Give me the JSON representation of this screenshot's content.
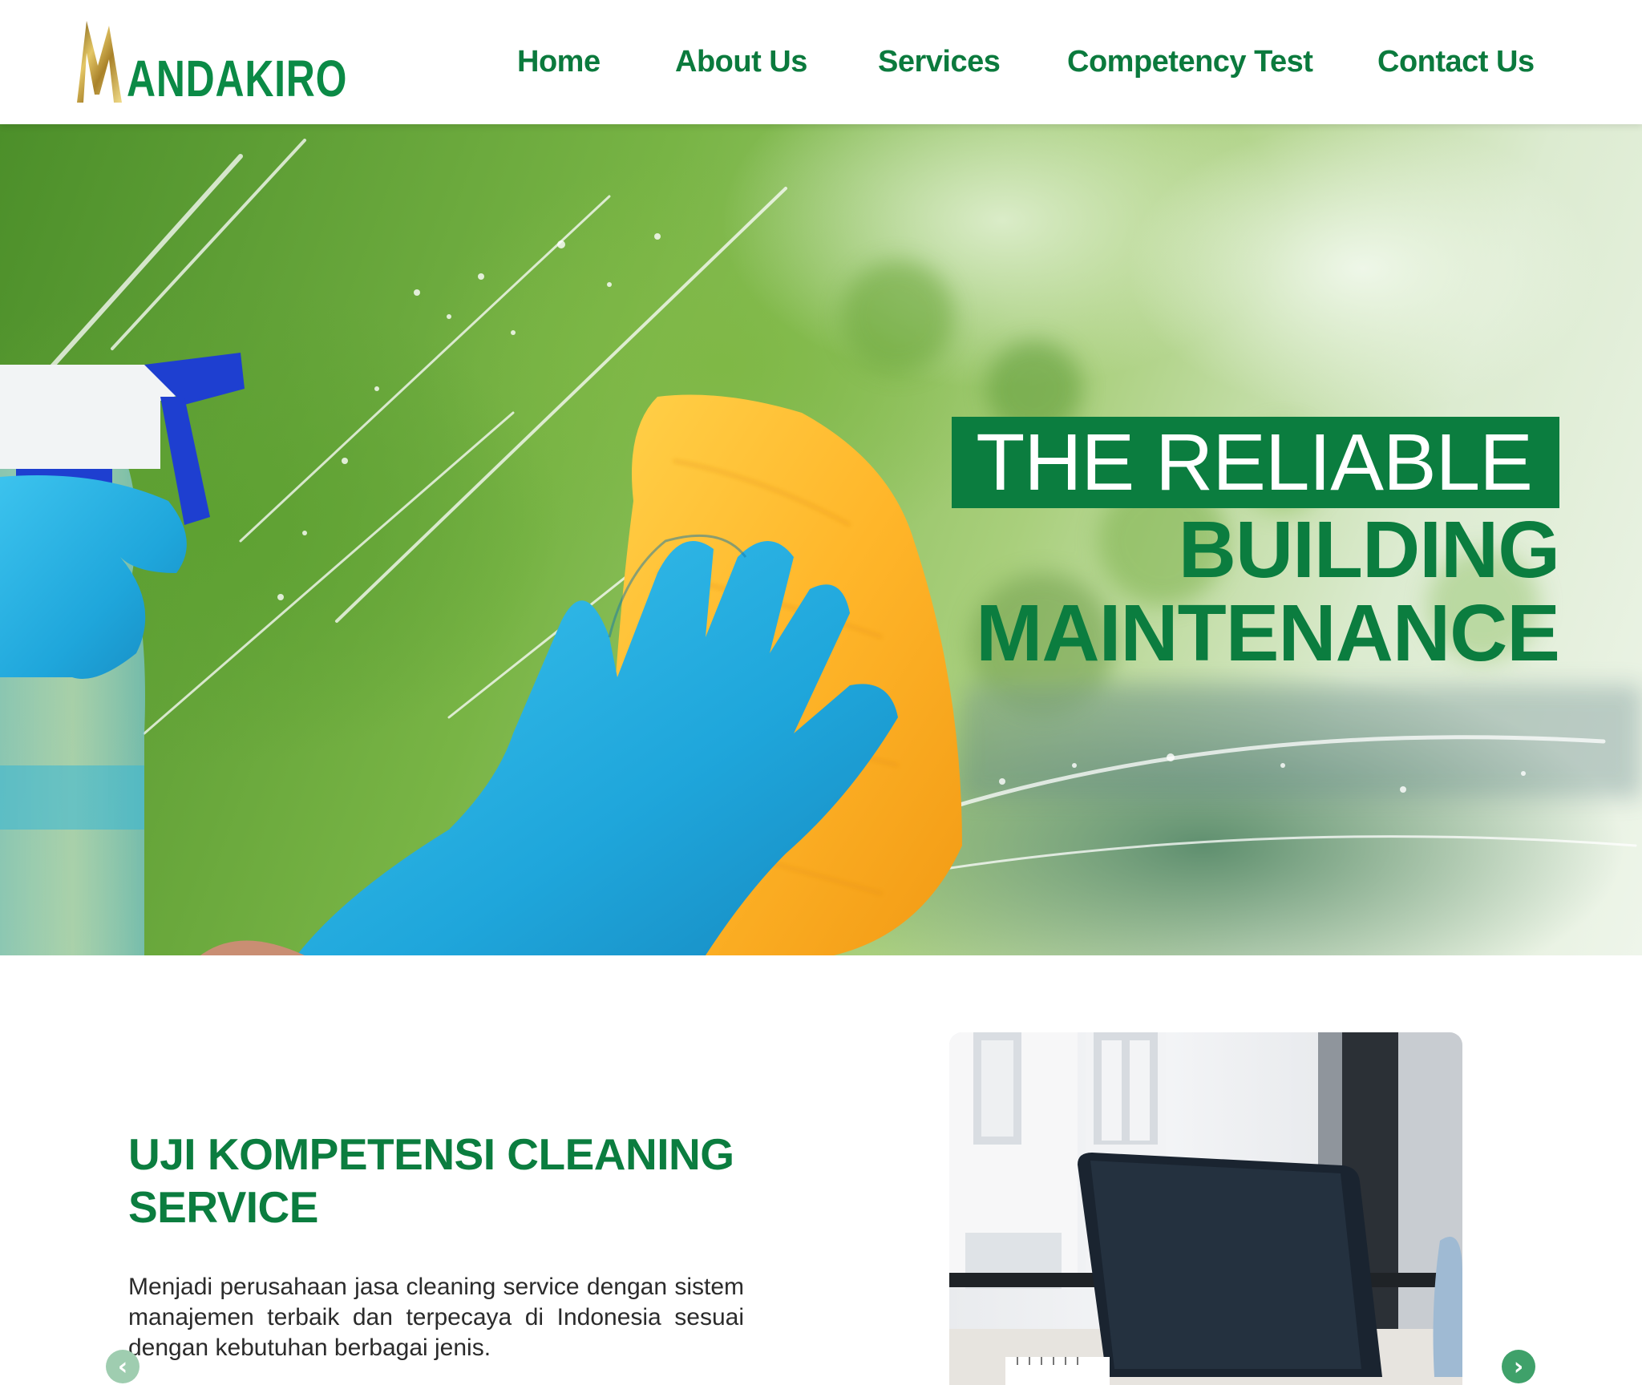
{
  "brand": {
    "name": "ANDAKIRO",
    "initial": "M",
    "colors": {
      "primary": "#0b7d3f",
      "gold": "#b8962e"
    }
  },
  "nav": {
    "items": [
      {
        "label": "Home"
      },
      {
        "label": "About Us"
      },
      {
        "label": "Services"
      },
      {
        "label": "Competency Test"
      },
      {
        "label": "Contact Us"
      }
    ]
  },
  "hero": {
    "line1": "THE RELIABLE",
    "line2": "BUILDING",
    "line3": "MAINTENANCE"
  },
  "section": {
    "heading": "UJI KOMPETENSI CLEANING SERVICE",
    "text": "Menjadi perusahaan jasa cleaning service dengan sistem manajemen terbaik dan terpecaya di Indonesia sesuai dengan kebutuhan berbagai jenis.",
    "carousel": {
      "prev_icon": "chevron-left-icon",
      "next_icon": "chevron-right-icon"
    }
  }
}
